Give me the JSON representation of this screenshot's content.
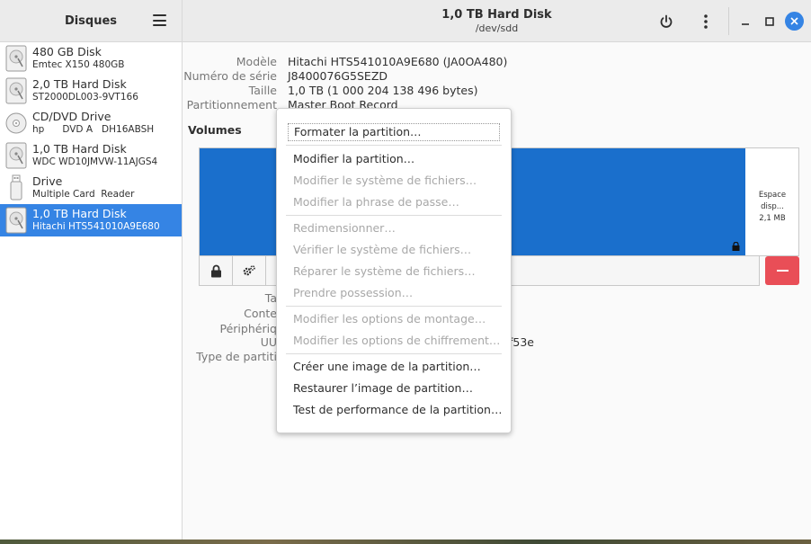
{
  "sidebar": {
    "title": "Disques",
    "items": [
      {
        "name": "480 GB Disk",
        "sub": "Emtec X150 480GB",
        "icon": "hard-disk-icon"
      },
      {
        "name": "2,0 TB Hard Disk",
        "sub": "ST2000DL003-9VT166",
        "icon": "hard-disk-icon"
      },
      {
        "name": "CD/DVD Drive",
        "sub": "hp      DVD A   DH16ABSH",
        "icon": "optical-disc-icon"
      },
      {
        "name": "1,0 TB Hard Disk",
        "sub": "WDC WD10JMVW-11AJGS4",
        "icon": "hard-disk-icon"
      },
      {
        "name": "Drive",
        "sub": "Multiple Card  Reader",
        "icon": "usb-drive-icon"
      },
      {
        "name": "1,0 TB Hard Disk",
        "sub": "Hitachi HTS541010A9E680",
        "icon": "hard-disk-icon",
        "selected": true
      }
    ]
  },
  "header": {
    "title": "1,0 TB Hard Disk",
    "subtitle": "/dev/sdd"
  },
  "details": {
    "model_label": "Modèle",
    "model_value": "Hitachi HTS541010A9E680 (JA0OA480)",
    "serial_label": "Numéro de série",
    "serial_value": "J8400076G5SEZD",
    "size_label": "Taille",
    "size_value": "1,0 TB (1 000 204 138 496 bytes)",
    "partitioning_label": "Partitionnement",
    "partitioning_value": "Master Boot Record",
    "volumes_label": "Volumes",
    "free_space_label": "Espace disp...",
    "free_space_size": "2,1 MB",
    "lower_labels": [
      "Ta",
      "Conte",
      "Périphériq",
      "UU",
      "Type de partiti"
    ],
    "uuid_fragment": "f53e"
  },
  "menu": {
    "items": [
      {
        "label": "Formater la partition…",
        "enabled": true
      },
      {
        "label": "Modifier la partition…",
        "enabled": true
      },
      {
        "label": "Modifier le système de fichiers…",
        "enabled": false
      },
      {
        "label": "Modifier la phrase de passe…",
        "enabled": false
      },
      {
        "label": "Redimensionner…",
        "enabled": false
      },
      {
        "label": "Vérifier le système de fichiers…",
        "enabled": false
      },
      {
        "label": "Réparer le système de fichiers…",
        "enabled": false
      },
      {
        "label": "Prendre possession…",
        "enabled": false
      },
      {
        "label": "Modifier les options de montage…",
        "enabled": false
      },
      {
        "label": "Modifier les options de chiffrement…",
        "enabled": false
      },
      {
        "label": "Créer une image de la partition…",
        "enabled": true
      },
      {
        "label": "Restaurer l’image de partition…",
        "enabled": true
      },
      {
        "label": "Test de performance de la partition…",
        "enabled": true
      }
    ]
  },
  "colors": {
    "accent": "#3584e4",
    "volume": "#1a6fcc",
    "destructive": "#e94e57"
  }
}
